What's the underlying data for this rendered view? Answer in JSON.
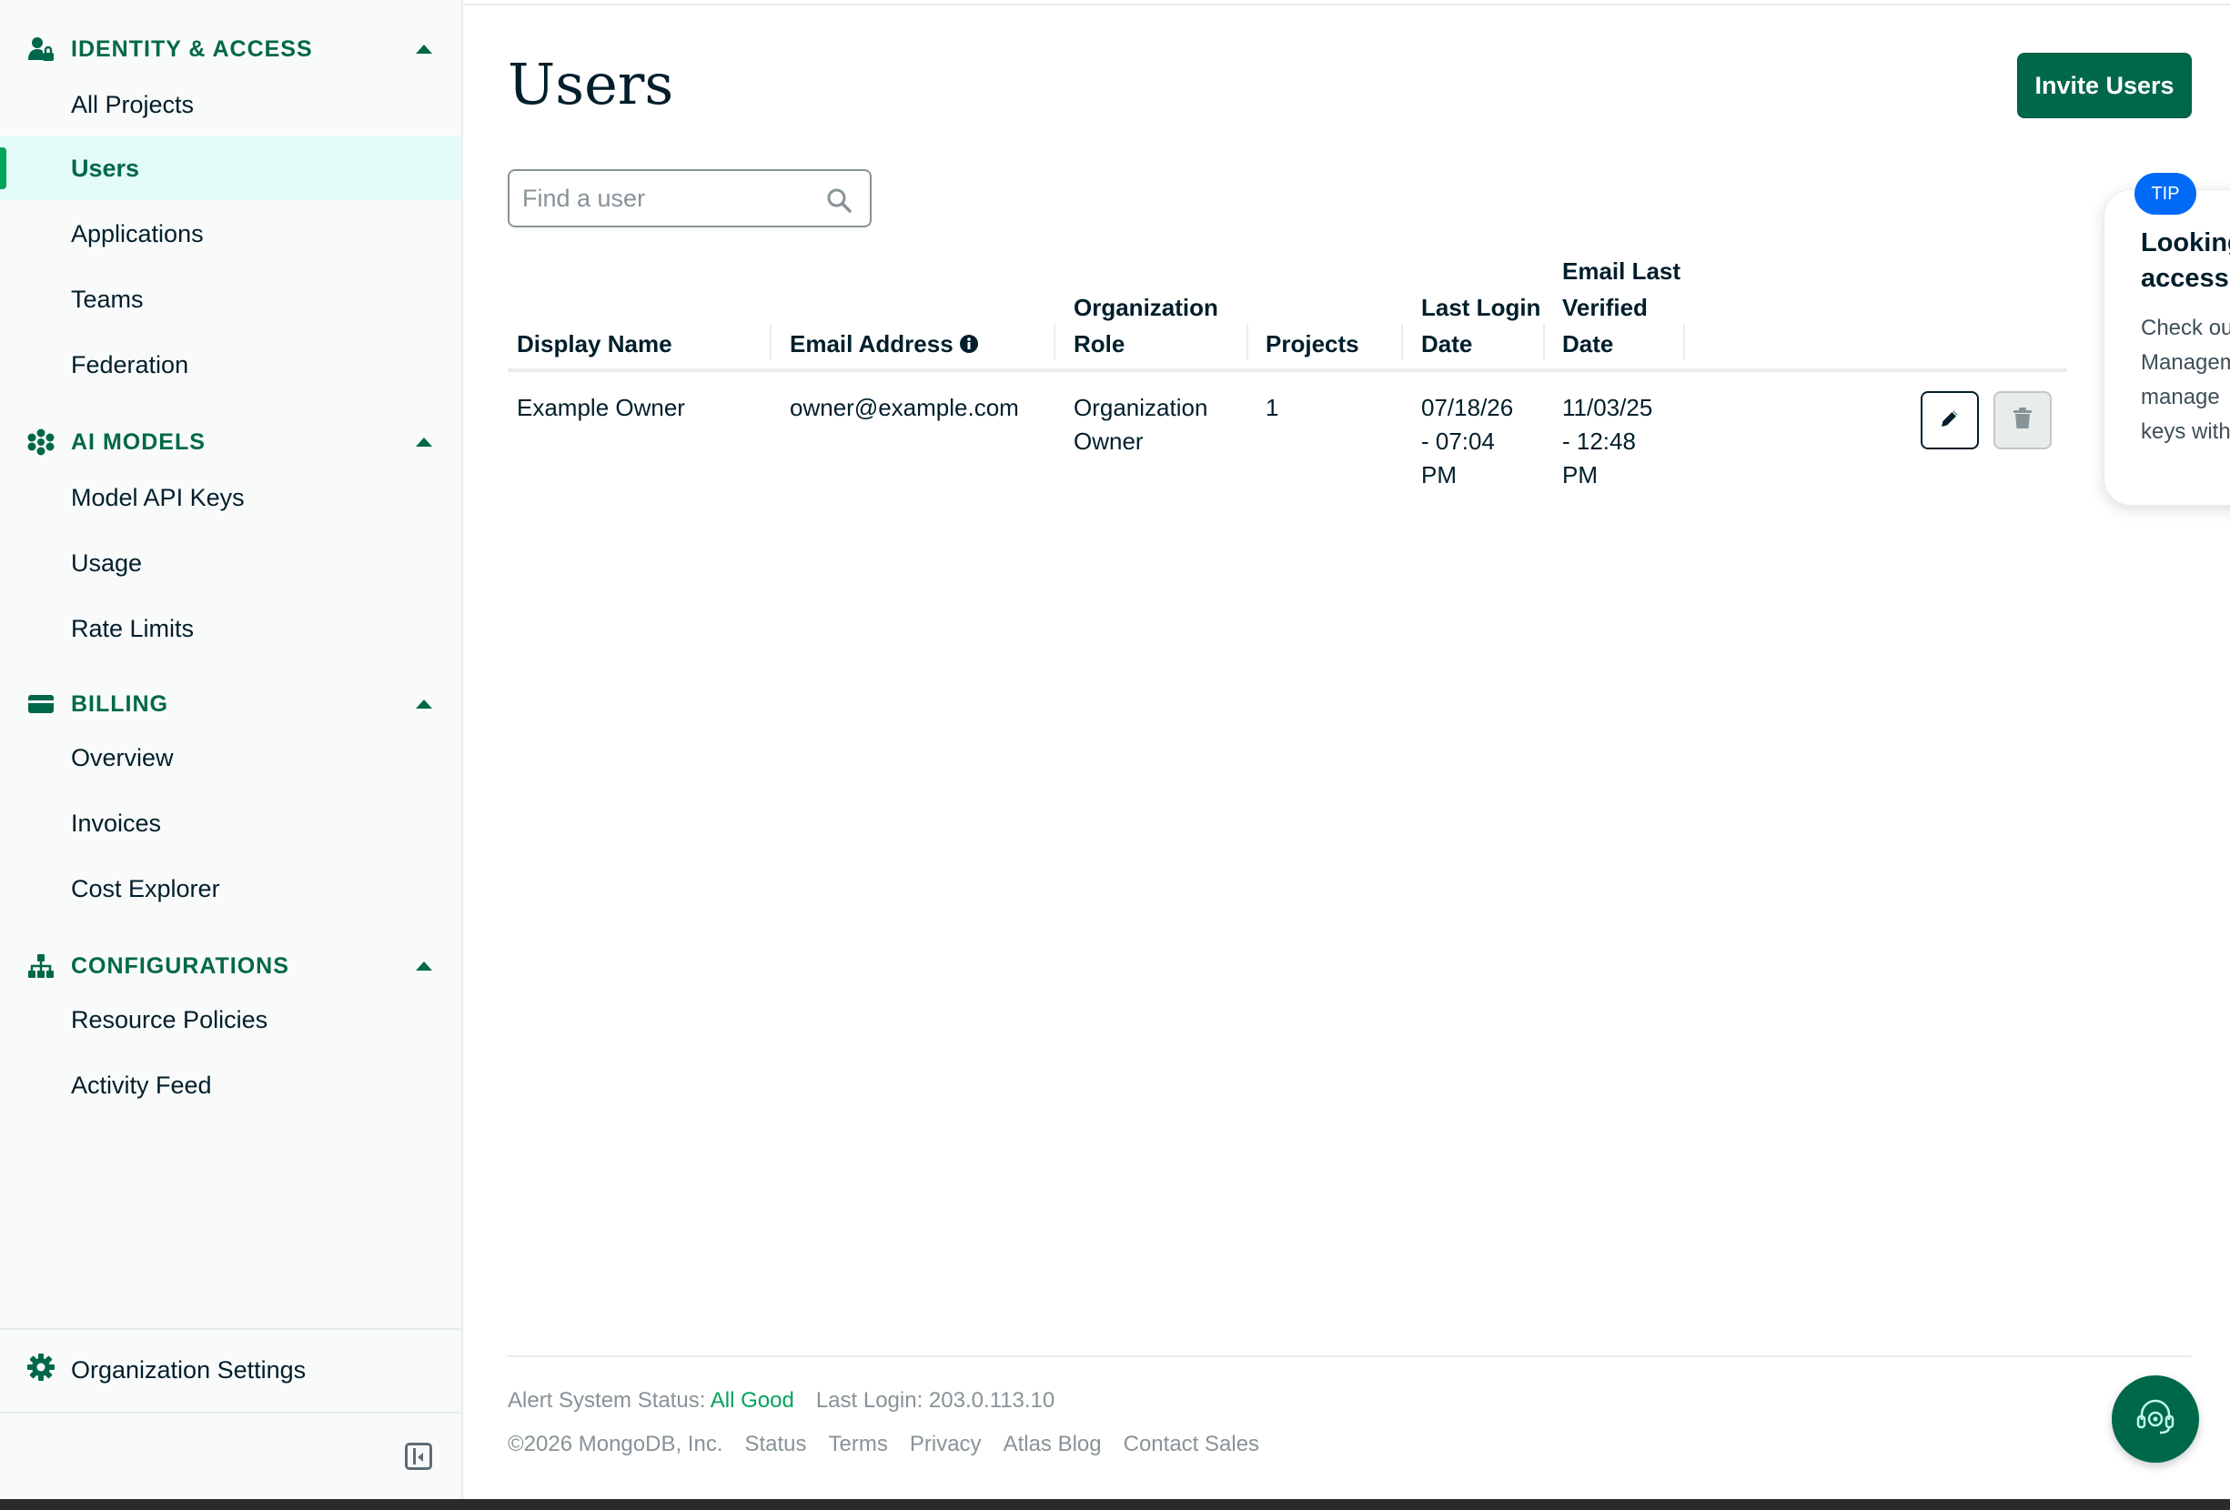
{
  "sidebar": {
    "sections": [
      {
        "title": "IDENTITY & ACCESS",
        "icon": "person-lock-icon",
        "items": [
          "All Projects",
          "Users",
          "Applications",
          "Teams",
          "Federation"
        ]
      },
      {
        "title": "AI MODELS",
        "icon": "ai-models-icon",
        "items": [
          "Model API Keys",
          "Usage",
          "Rate Limits"
        ]
      },
      {
        "title": "BILLING",
        "icon": "credit-card-icon",
        "items": [
          "Overview",
          "Invoices",
          "Cost Explorer"
        ]
      },
      {
        "title": "CONFIGURATIONS",
        "icon": "hierarchy-icon",
        "items": [
          "Resource Policies",
          "Activity Feed"
        ]
      }
    ],
    "active_item": "Users",
    "org_settings": "Organization Settings"
  },
  "main": {
    "title": "Users",
    "invite_label": "Invite Users",
    "search": {
      "placeholder": "Find a user",
      "value": ""
    },
    "table": {
      "headers": {
        "display_name": "Display Name",
        "email": "Email Address",
        "org_role_1": "Organization",
        "org_role_2": "Role",
        "projects": "Projects",
        "last_login_1": "Last Login",
        "last_login_2": "Date",
        "email_verified_1": "Email Last",
        "email_verified_2": "Verified",
        "email_verified_3": "Date"
      },
      "rows": [
        {
          "display_name": "Example Owner",
          "email": "owner@example.com",
          "org_role_1": "Organization",
          "org_role_2": "Owner",
          "projects": "1",
          "last_login_1": "07/18/26",
          "last_login_2": "- 07:04",
          "last_login_3": "PM",
          "email_verified_1": "11/03/25",
          "email_verified_2": "- 12:48",
          "email_verified_3": "PM"
        }
      ]
    }
  },
  "tip": {
    "badge": "TIP",
    "title_1": "Looking",
    "title_2": "access",
    "body_1": "Check out",
    "body_2": "Managem",
    "body_3": "manage",
    "body_4": "keys with"
  },
  "footer": {
    "alert_label": "Alert System Status:",
    "alert_value": "All Good",
    "last_login": "Last Login: 203.0.113.10",
    "copyright": "©2026 MongoDB, Inc.",
    "links": [
      "Status",
      "Terms",
      "Privacy",
      "Atlas Blog",
      "Contact Sales"
    ]
  },
  "colors": {
    "brand_green": "#00684A",
    "accent_green": "#00A35C",
    "tip_blue": "#016BF8"
  }
}
